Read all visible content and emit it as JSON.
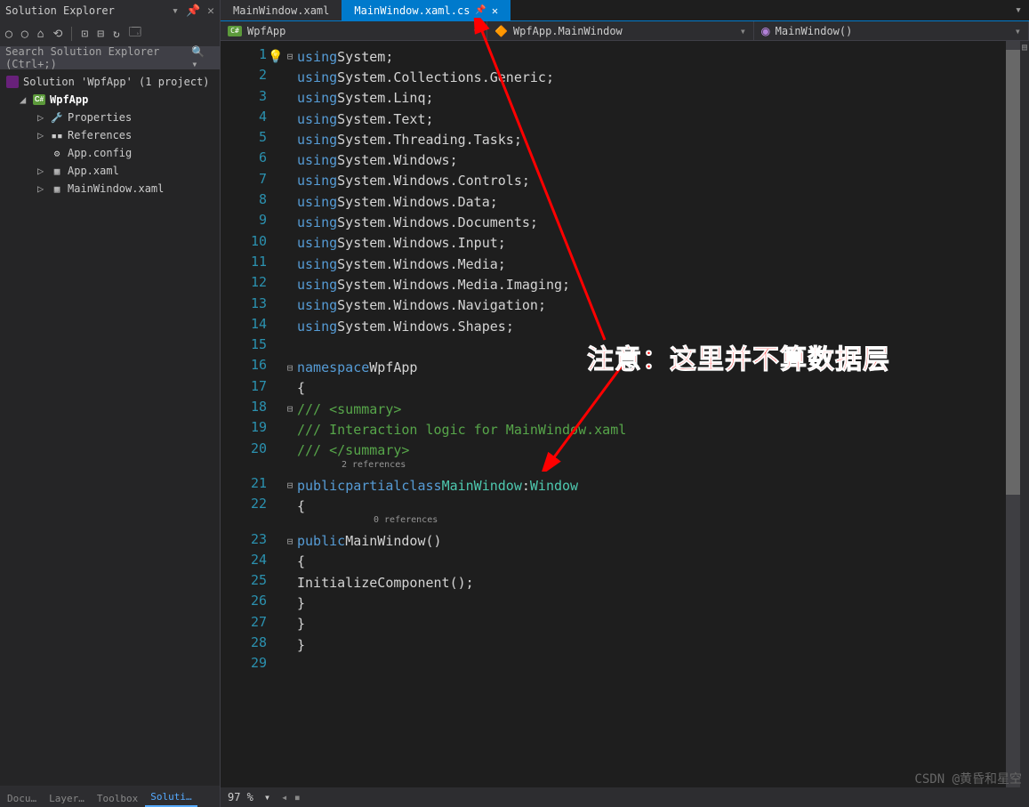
{
  "sidebar": {
    "title": "Solution Explorer",
    "search_placeholder": "Search Solution Explorer (Ctrl+;)",
    "solution": "Solution 'WpfApp' (1 project)",
    "project": "WpfApp",
    "items": [
      "Properties",
      "References",
      "App.config",
      "App.xaml",
      "MainWindow.xaml"
    ]
  },
  "paneltabs": {
    "t1": "Docu…",
    "t2": "Layer…",
    "t3": "Toolbox",
    "t4": "Soluti…"
  },
  "tabs": {
    "inactive": "MainWindow.xaml",
    "active": "MainWindow.xaml.cs"
  },
  "nav": {
    "b1": "WpfApp",
    "b2": "WpfApp.MainWindow",
    "b3": "MainWindow()"
  },
  "linenumbers": [
    1,
    2,
    3,
    4,
    5,
    6,
    7,
    8,
    9,
    10,
    11,
    12,
    13,
    14,
    15,
    16,
    17,
    18,
    19,
    20,
    21,
    22,
    23,
    24,
    25,
    26,
    27,
    28,
    29
  ],
  "refs": {
    "r1": "2 references",
    "r2": "0 references"
  },
  "code": {
    "usings": [
      "System",
      "System.Collections.Generic",
      "System.Linq",
      "System.Text",
      "System.Threading.Tasks",
      "System.Windows",
      "System.Windows.Controls",
      "System.Windows.Data",
      "System.Windows.Documents",
      "System.Windows.Input",
      "System.Windows.Media",
      "System.Windows.Media.Imaging",
      "System.Windows.Navigation",
      "System.Windows.Shapes"
    ],
    "kw_using": "using",
    "kw_namespace": "namespace",
    "kw_public": "public",
    "kw_partial": "partial",
    "kw_class": "class",
    "ns": "WpfApp",
    "cls": "MainWindow",
    "base": "Window",
    "c1": "/// <summary>",
    "c2": "/// Interaction logic for MainWindow.xaml",
    "c3": "/// </summary>",
    "ctor": "MainWindow()",
    "init": "InitializeComponent();"
  },
  "annotation": "注意：这里并不算数据层",
  "status": {
    "zoom": "97 %"
  },
  "watermark": "CSDN @黄昏和星空"
}
